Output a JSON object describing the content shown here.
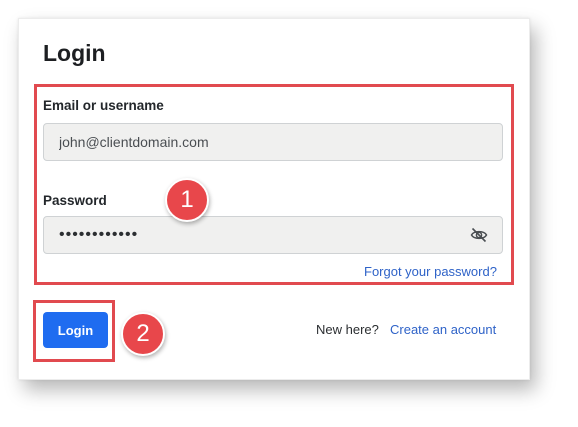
{
  "login_form": {
    "title": "Login",
    "email_label": "Email or username",
    "email_value": "john@clientdomain.com",
    "password_label": "Password",
    "password_value": "••••••••••••",
    "forgot_password_link": "Forgot your password?",
    "login_button": "Login",
    "new_here_text": "New here?",
    "create_account_link": "Create an account"
  },
  "annotations": {
    "callout_1": "1",
    "callout_2": "2"
  },
  "icons": {
    "password_toggle": "eye-slash-icon"
  },
  "colors": {
    "primary_button": "#1f6cf0",
    "link": "#2f63c8",
    "callout": "#e14a4f"
  }
}
